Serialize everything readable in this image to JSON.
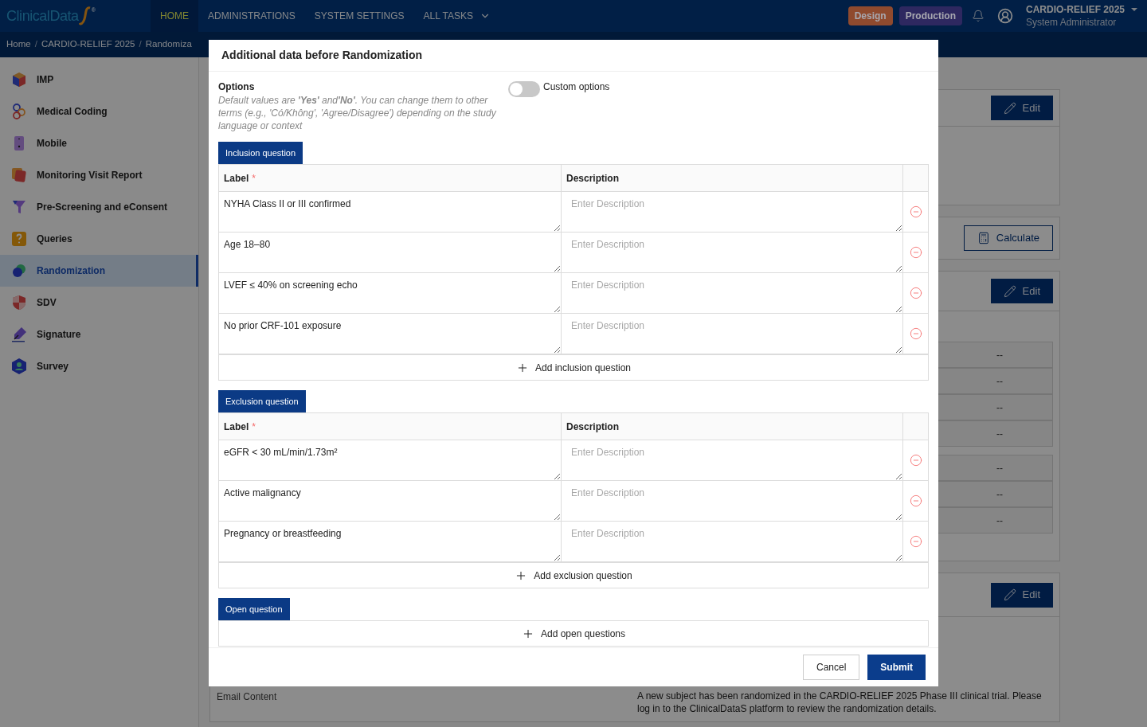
{
  "topbar": {
    "logo": "ClinicalData",
    "logo_mark": "®",
    "nav": [
      {
        "label": "HOME",
        "selected": true
      },
      {
        "label": "ADMINISTRATIONS",
        "selected": false
      },
      {
        "label": "SYSTEM SETTINGS",
        "selected": false
      },
      {
        "label": "ALL TASKS",
        "selected": false
      }
    ],
    "env_badges": [
      {
        "label": "Design",
        "color": "#8f4a2e"
      },
      {
        "label": "Production",
        "color": "#2e2860"
      }
    ],
    "study": "CARDIO-RELIEF 2025",
    "role": "System Administrator"
  },
  "breadcrumb": {
    "items": [
      "Home",
      "CARDIO-RELIEF 2025",
      "Randomiza"
    ],
    "separators": [
      "/",
      "/"
    ]
  },
  "sidebar": {
    "items": [
      {
        "label": "IMP",
        "selected": false
      },
      {
        "label": "Medical Coding",
        "selected": false
      },
      {
        "label": "Mobile",
        "selected": false
      },
      {
        "label": "Monitoring Visit Report",
        "selected": false
      },
      {
        "label": "Pre-Screening and eConsent",
        "selected": false
      },
      {
        "label": "Queries",
        "selected": false
      },
      {
        "label": "Randomization",
        "selected": true
      },
      {
        "label": "SDV",
        "selected": false
      },
      {
        "label": "Signature",
        "selected": false
      },
      {
        "label": "Survey",
        "selected": false
      }
    ]
  },
  "background": {
    "edit_buttons": [
      "Edit",
      "Edit",
      "Edit"
    ],
    "calculate_button": "Calculate",
    "table_1": [
      "--",
      "--",
      "--",
      "--"
    ],
    "table_2": [
      "--",
      "--",
      "--"
    ],
    "email_content": {
      "label": "Email Content",
      "text": "A new subject has been randomized in the CARDIO-RELIEF 2025 Phase III clinical trial. Please log in to the ClinicalDataS platform to review the randomization details."
    }
  },
  "dialog": {
    "title": "Additional data before Randomization",
    "options": {
      "label": "Options",
      "hint": "Default values are **'Yes'** and**'No'**. You can change them to other terms (e.g., 'Có/Không', 'Agree/Disagree') depending on the study language or context"
    },
    "custom_options": {
      "label": "Custom options",
      "on": false
    },
    "sections": [
      {
        "kind": "table",
        "title": "Inclusion question",
        "columns": [
          {
            "label": "Label",
            "required": true
          },
          {
            "label": "Description",
            "required": false
          }
        ],
        "rows": [
          {
            "label": "NYHA Class II or III confirmed",
            "description_placeholder": "Enter Description"
          },
          {
            "label": "Age 18–80",
            "description_placeholder": "Enter Description"
          },
          {
            "label": "LVEF ≤ 40% on screening echo",
            "description_placeholder": "Enter Description"
          },
          {
            "label": "No prior CRF-101 exposure",
            "description_placeholder": "Enter Description"
          }
        ],
        "add_label": "Add inclusion question"
      },
      {
        "kind": "table",
        "title": "Exclusion question",
        "columns": [
          {
            "label": "Label",
            "required": true
          },
          {
            "label": "Description",
            "required": false
          }
        ],
        "rows": [
          {
            "label": "eGFR < 30 mL/min/1.73m²",
            "description_placeholder": "Enter Description"
          },
          {
            "label": "Active malignancy",
            "description_placeholder": "Enter Description"
          },
          {
            "label": "Pregnancy or breastfeeding",
            "description_placeholder": "Enter Description"
          }
        ],
        "add_label": "Add exclusion question"
      },
      {
        "kind": "list",
        "title": "Open question",
        "add_label": "Add open questions"
      }
    ],
    "required_mark": "*",
    "buttons": [
      {
        "label": "Cancel",
        "kind": "secondary"
      },
      {
        "label": "Submit",
        "kind": "primary"
      }
    ]
  }
}
